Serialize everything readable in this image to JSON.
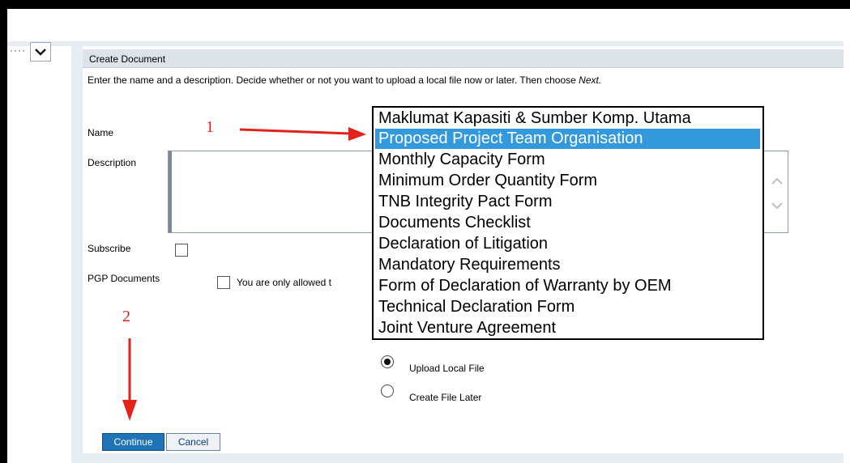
{
  "dialog": {
    "title": "Create Document",
    "instructions_prefix": "Enter the name and a description. Decide whether or not you want to upload a local file now or later. Then choose ",
    "instructions_emphasis": "Next.",
    "name_label": "Name",
    "description_label": "Description",
    "subscribe_label": "Subscribe",
    "pgp_label": "PGP Documents",
    "pgp_note": "You are only allowed t",
    "name_dropdown": {
      "selected": "Proposed Project Team Organisation",
      "options": [
        "Maklumat Kapasiti & Sumber Komp. Utama",
        "Proposed Project Team Organisation",
        "Monthly Capacity Form",
        "Minimum Order Quantity Form",
        "TNB Integrity Pact Form",
        "Documents Checklist",
        "Declaration of Litigation",
        "Mandatory Requirements",
        "Form of Declaration of Warranty by OEM",
        "Technical Declaration Form",
        "Joint Venture Agreement"
      ]
    },
    "upload_options": [
      {
        "label": "Upload Local File",
        "selected": true
      },
      {
        "label": "Create File Later",
        "selected": false
      }
    ],
    "continue_label": "Continue",
    "cancel_label": "Cancel"
  },
  "left_panel": {
    "ellipsis": "····"
  },
  "annotations": {
    "step1": "1",
    "step2": "2",
    "color": "#e3231b"
  },
  "colors": {
    "selected_option_bg": "#3399dd",
    "continue_button_bg": "#1f73b7",
    "header_bg": "#dde3ea"
  },
  "icons": [
    "chevron-down-icon",
    "scroll-up-icon",
    "scroll-down-icon",
    "red-arrow-icon"
  ]
}
